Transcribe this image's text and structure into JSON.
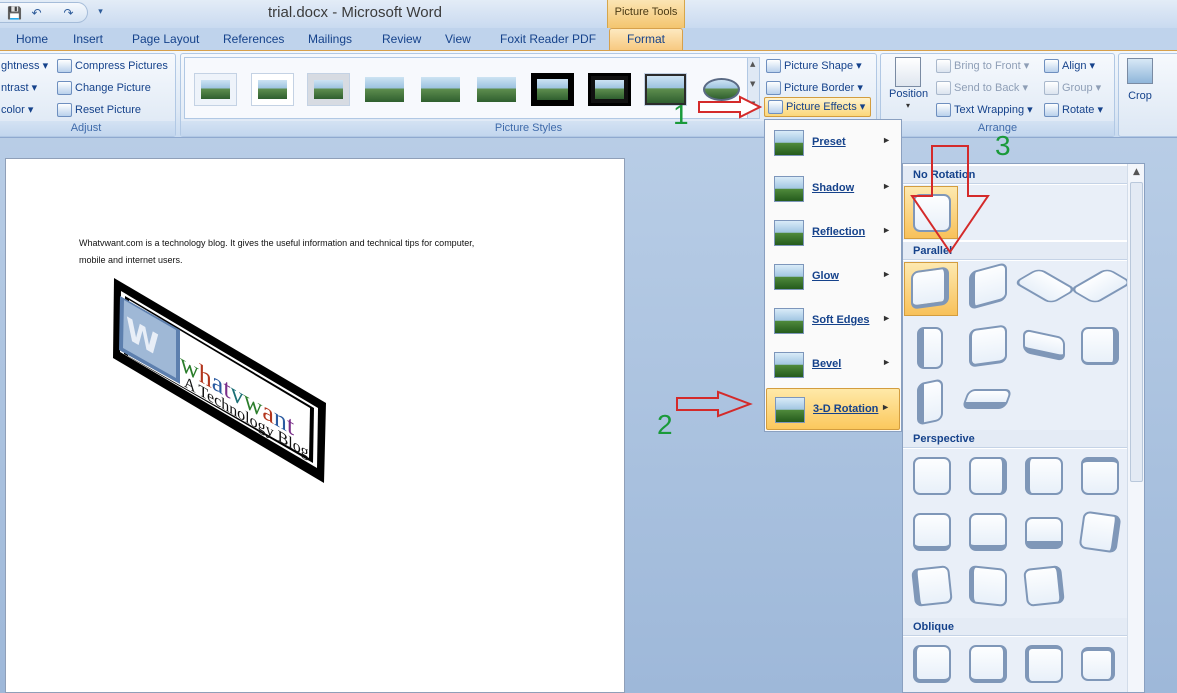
{
  "title": {
    "text": "trial.docx - Microsoft Word",
    "context_tab": "Picture Tools"
  },
  "tabs": [
    "Home",
    "Insert",
    "Page Layout",
    "References",
    "Mailings",
    "Review",
    "View",
    "Foxit Reader PDF",
    "Format"
  ],
  "ribbon": {
    "adjust": {
      "label": "Adjust",
      "left_items": [
        "ghtness",
        "ntrast",
        "color"
      ],
      "compress": "Compress Pictures",
      "change": "Change Picture",
      "reset": "Reset Picture"
    },
    "picture_styles": {
      "label": "Picture Styles",
      "shape": "Picture Shape",
      "border": "Picture Border",
      "effects": "Picture Effects"
    },
    "arrange": {
      "label": "Arrange",
      "position": "Position",
      "bring_to_front": "Bring to Front",
      "send_to_back": "Send to Back",
      "text_wrapping": "Text Wrapping",
      "align": "Align",
      "group": "Group",
      "rotate": "Rotate"
    },
    "size": {
      "crop": "Crop"
    }
  },
  "document": {
    "line1": "Whatvwant.com is a technology blog. It gives the useful information and technical tips for computer,",
    "line2": "mobile and internet users.",
    "logo_lines": [
      "whatvwant",
      "A Technology Blog"
    ]
  },
  "effects_menu": {
    "items": [
      "Preset",
      "Shadow",
      "Reflection",
      "Glow",
      "Soft Edges",
      "Bevel",
      "3-D Rotation"
    ],
    "active": "3-D Rotation"
  },
  "rotation_gallery": {
    "sections": [
      "No Rotation",
      "Parallel",
      "Perspective",
      "Oblique"
    ]
  },
  "annotations": {
    "steps": [
      "1",
      "2",
      "3"
    ],
    "arrow_color": "#d42a2a",
    "number_color": "#1a9a3a"
  }
}
